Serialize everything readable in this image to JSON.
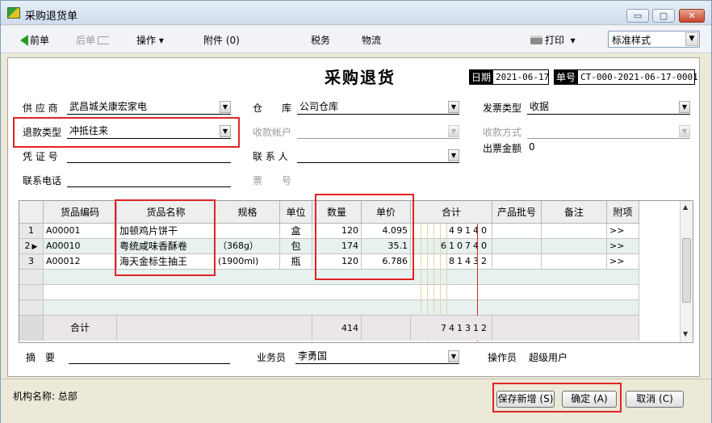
{
  "window": {
    "title": "采购退货单",
    "min_glyph": "▭",
    "max_glyph": "▢",
    "close_glyph": "✕"
  },
  "toolbar": {
    "prev": "前单",
    "next": "后单",
    "operation": "操作",
    "operation_caret": "▾",
    "attachment": "附件 (0)",
    "tax": "税务",
    "logistics": "物流",
    "print": "打印",
    "print_caret": "▾",
    "style_value": "标准样式",
    "dd_glyph": "▼"
  },
  "form": {
    "title": "采购退货",
    "date_label": "日期",
    "date_value": "2021-06-17",
    "doc_label": "单号",
    "doc_value": "CT-000-2021-06-17-0001",
    "supplier_label": "供 应 商",
    "supplier_value": "武昌城关康宏家电",
    "warehouse_label": "仓　　库",
    "warehouse_value": "公司仓库",
    "invoice_type_label": "发票类型",
    "invoice_type_value": "收据",
    "refund_type_label": "退款类型",
    "refund_type_value": "冲抵往来",
    "receive_account_label": "收款帐户",
    "receive_method_label": "收款方式",
    "voucher_label": "凭 证 号",
    "contact_label": "联 系 人",
    "invoice_amount_label": "出票金额",
    "invoice_amount_value": "0",
    "phone_label": "联系电话",
    "ticket_label": "票　　号",
    "summary_label": "摘　要",
    "salesman_label": "业务员",
    "salesman_value": "李勇国",
    "operator_label": "操作员",
    "operator_value": "超级用户",
    "dd_glyph": "▼"
  },
  "grid": {
    "headers": [
      "货品编码",
      "货品名称",
      "规格",
      "单位",
      "数量",
      "单价",
      "合计",
      "产品批号",
      "备注",
      "附项"
    ],
    "rows": [
      {
        "no": "1",
        "code": "A00001",
        "name": "加顿鸡片饼干",
        "spec": "",
        "unit": "盒",
        "qty": "120",
        "price": "4.095",
        "total": "49140",
        "attach": ">>"
      },
      {
        "no": "2",
        "code": "A00010",
        "name": "粤统咸味香酥卷",
        "spec": "（368g）",
        "unit": "包",
        "qty": "174",
        "price": "35.1",
        "total": "610740",
        "attach": ">>"
      },
      {
        "no": "3",
        "code": "A00012",
        "name": "海天金标生抽王",
        "spec": "(1900ml)",
        "unit": "瓶",
        "qty": "120",
        "price": "6.786",
        "total": "81432",
        "attach": ">>"
      }
    ],
    "current_row_marker": "▶",
    "sum_label": "合计",
    "sum_qty": "414",
    "sum_total": "741312",
    "scroll_up": "▲",
    "scroll_down": "▼"
  },
  "status": {
    "org": "机构名称: 总部"
  },
  "buttons": {
    "save_new": "保存新增 (S)",
    "ok": "确定 (A)",
    "cancel": "取消 (C)"
  },
  "colors": {
    "highlight": "#e02424",
    "row_alt": "#e7f1ef"
  }
}
